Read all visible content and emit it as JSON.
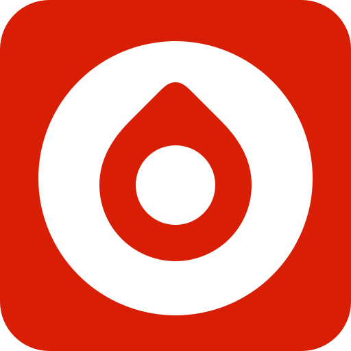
{
  "icon": {
    "name": "red-drop-in-ring-app-icon",
    "colors": {
      "tile": "#d81e05",
      "ring": "#ffffff",
      "drop": "#d81e05",
      "drop_hole": "#ffffff"
    }
  }
}
